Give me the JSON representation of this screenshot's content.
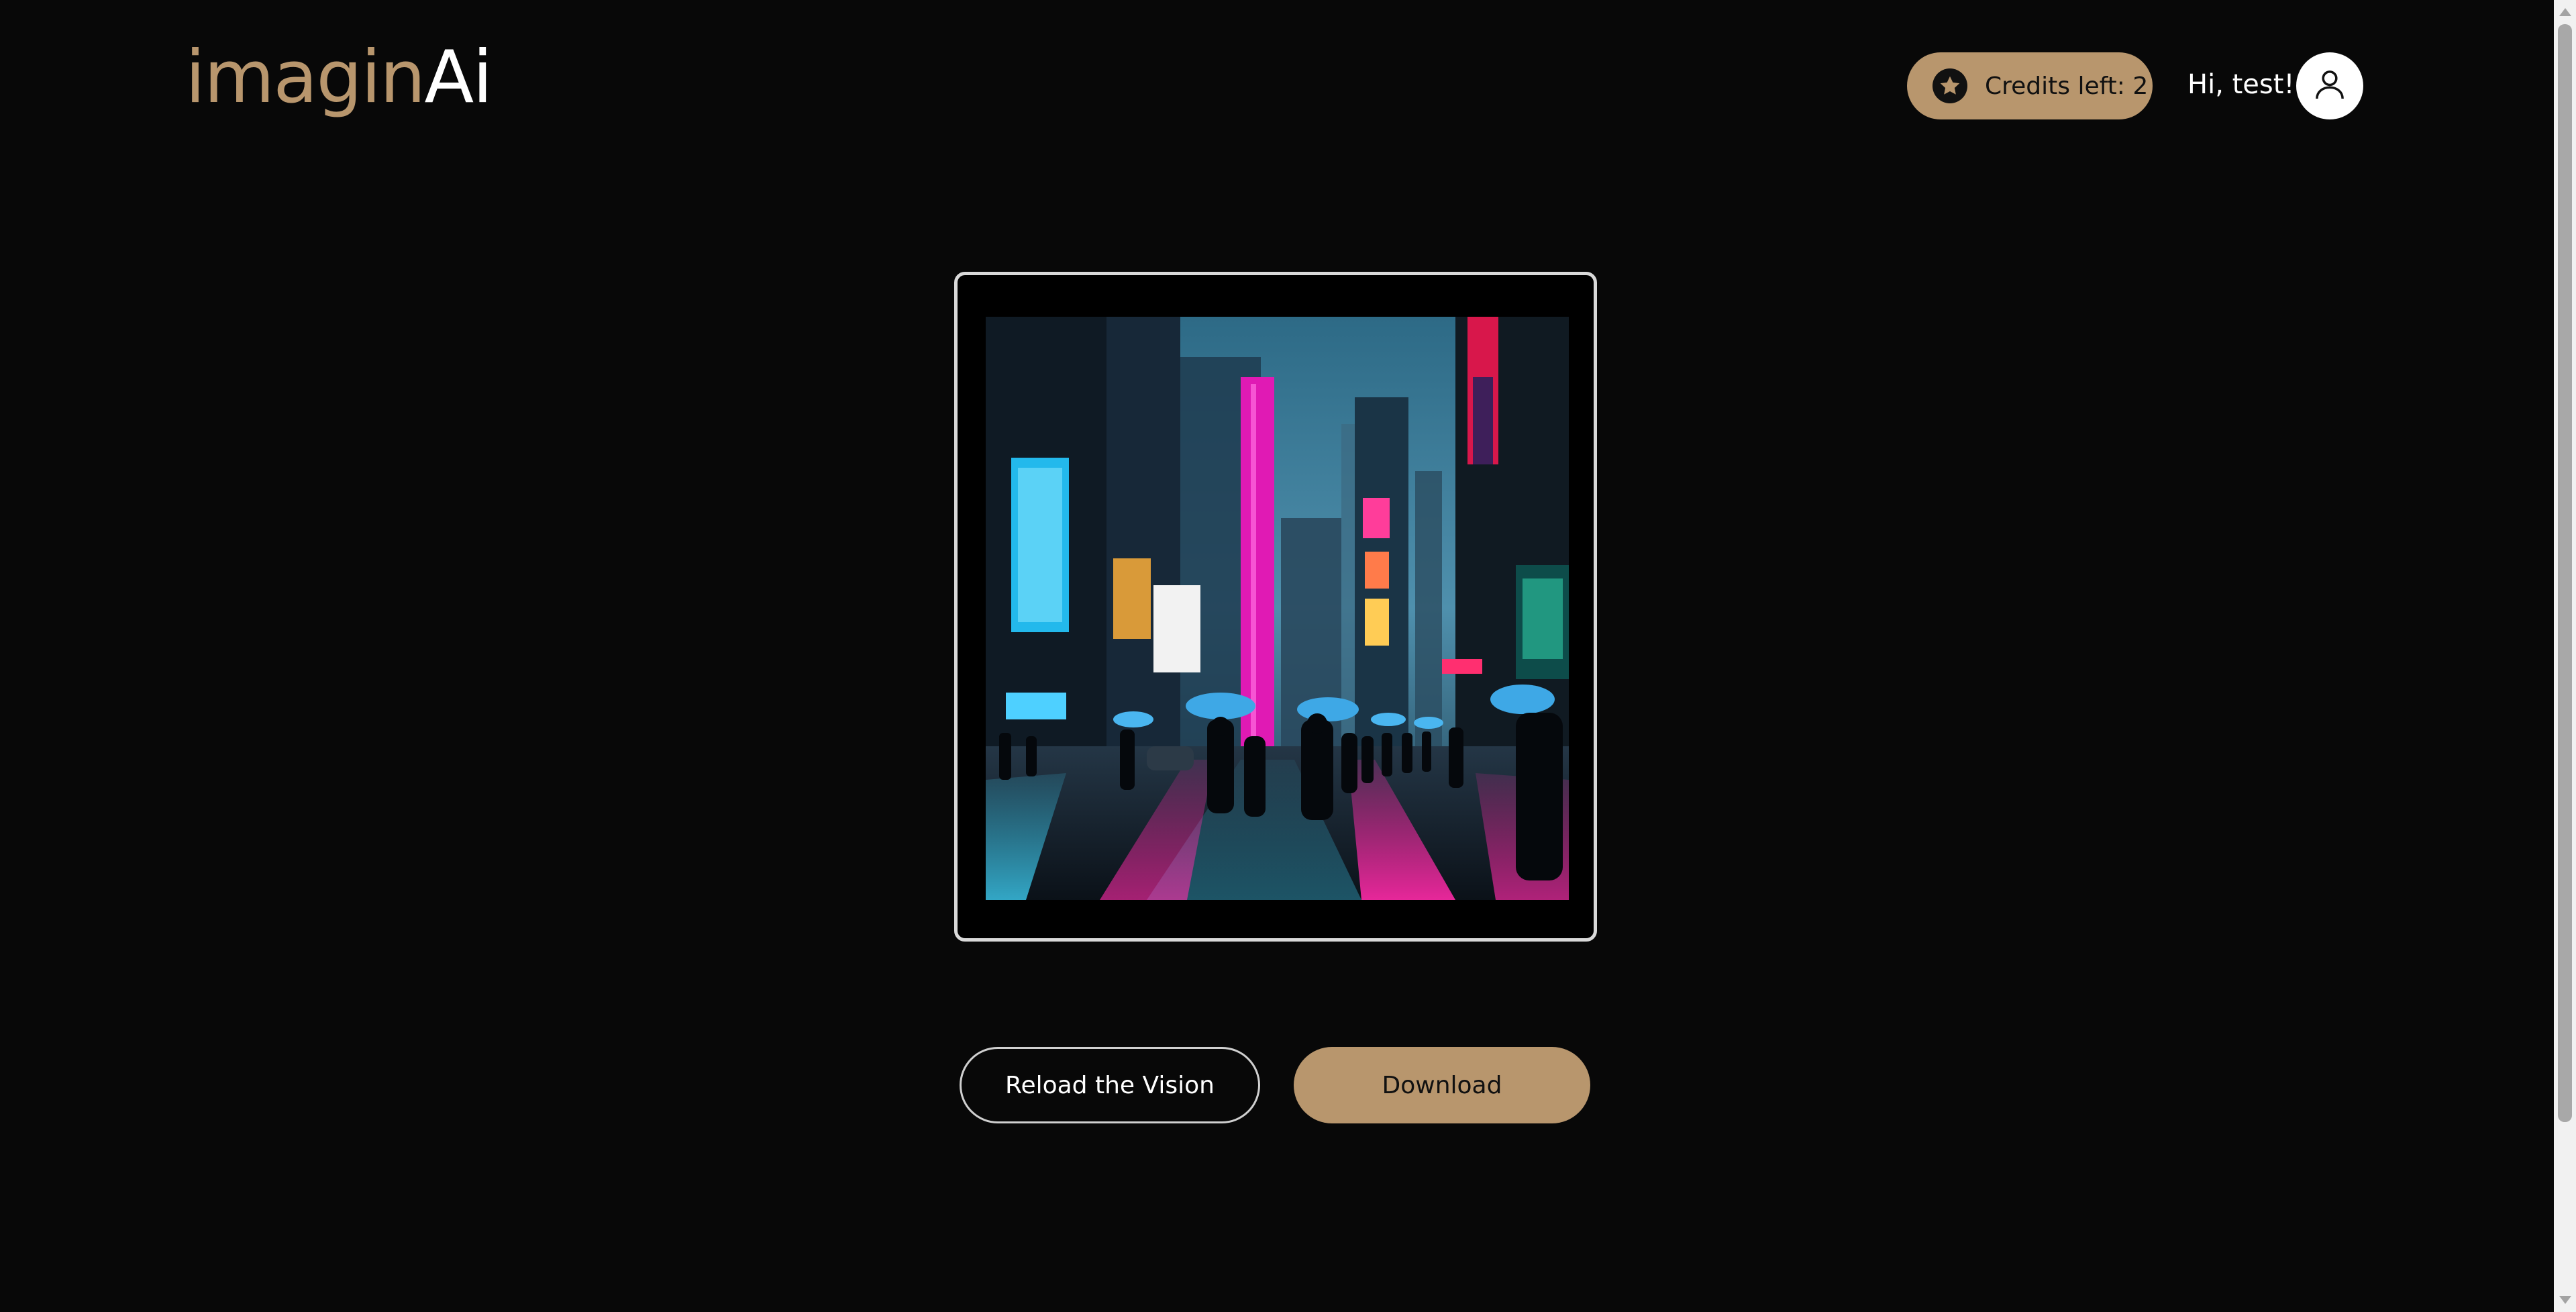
{
  "header": {
    "logo_part1": "imagin",
    "logo_part2": "Ai",
    "credits_label": "Credits left: 2",
    "greeting": "Hi, test!"
  },
  "icons": {
    "credits": "star-icon",
    "avatar": "user-icon",
    "scroll_up": "arrow-up-icon",
    "scroll_down": "arrow-down-icon"
  },
  "main": {
    "image_alt": "Generated image: rainy neon-lit city street with pedestrians holding umbrellas",
    "reload_label": "Reload the Vision",
    "download_label": "Download"
  },
  "colors": {
    "background": "#080808",
    "accent": "#b8966d",
    "frame_border": "#d9d9d9",
    "text": "#ffffff"
  }
}
